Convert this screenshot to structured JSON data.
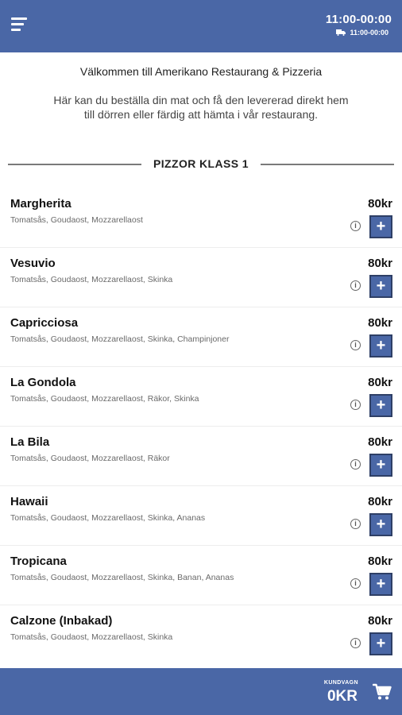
{
  "header": {
    "hours_main": "11:00-00:00",
    "hours_delivery": "11:00-00:00"
  },
  "intro": {
    "welcome": "Välkommen till Amerikano Restaurang & Pizzeria",
    "description": "Här kan du beställa din mat och få den levererad direkt hem till dörren eller färdig att hämta i vår restaurang."
  },
  "section": {
    "title": "PIZZOR KLASS 1"
  },
  "items": [
    {
      "name": "Margherita",
      "desc": "Tomatsås, Goudaost, Mozzarellaost",
      "price": "80kr"
    },
    {
      "name": "Vesuvio",
      "desc": "Tomatsås, Goudaost, Mozzarellaost, Skinka",
      "price": "80kr"
    },
    {
      "name": "Capricciosa",
      "desc": "Tomatsås, Goudaost, Mozzarellaost, Skinka, Champinjoner",
      "price": "80kr"
    },
    {
      "name": "La Gondola",
      "desc": "Tomatsås, Goudaost, Mozzarellaost, Räkor, Skinka",
      "price": "80kr"
    },
    {
      "name": "La Bila",
      "desc": "Tomatsås, Goudaost, Mozzarellaost, Räkor",
      "price": "80kr"
    },
    {
      "name": "Hawaii",
      "desc": "Tomatsås, Goudaost, Mozzarellaost, Skinka, Ananas",
      "price": "80kr"
    },
    {
      "name": "Tropicana",
      "desc": "Tomatsås, Goudaost, Mozzarellaost, Skinka, Banan, Ananas",
      "price": "80kr"
    },
    {
      "name": "Calzone (Inbakad)",
      "desc": "Tomatsås, Goudaost, Mozzarellaost, Skinka",
      "price": "80kr"
    }
  ],
  "buttons": {
    "add_label": "+",
    "info_label": "i"
  },
  "cart": {
    "label": "KUNDVAGN",
    "total": "0KR"
  },
  "icons": {
    "menu": "hamburger-icon",
    "delivery": "truck-icon",
    "cart": "shopping-cart-icon",
    "info": "info-icon"
  },
  "colors": {
    "brand": "#4a67a6",
    "button_border": "#2e3f66"
  }
}
